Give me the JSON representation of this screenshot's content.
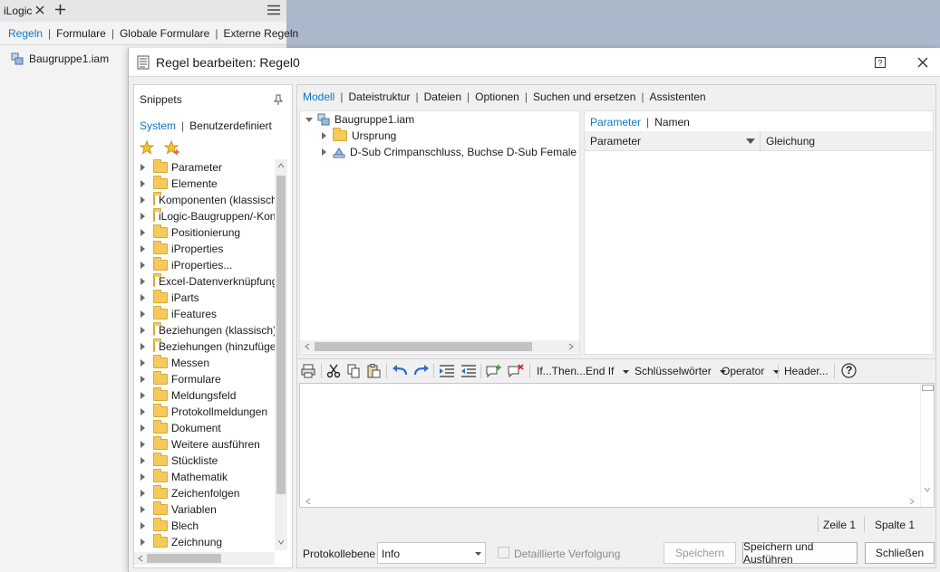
{
  "left_panel": {
    "title": "iLogic",
    "tabs": [
      "Regeln",
      "Formulare",
      "Globale Formulare",
      "Externe Regeln"
    ],
    "active_tab": "Regeln",
    "tree_item": "Baugruppe1.iam"
  },
  "dialog": {
    "title": "Regel bearbeiten: Regel0",
    "help_icon": "help-icon",
    "close_icon": "close-icon"
  },
  "snippets": {
    "title": "Snippets",
    "tabs": [
      "System",
      "Benutzerdefiniert"
    ],
    "active_tab": "System",
    "items": [
      "Parameter",
      "Elemente",
      "Komponenten (klassisch)",
      "iLogic-Baugruppen/-Konstruktion",
      "Positionierung",
      "iProperties",
      "iProperties...",
      "Excel-Datenverknüpfung",
      "iParts",
      "iFeatures",
      "Beziehungen (klassisch)",
      "Beziehungen (hinzufügen)",
      "Messen",
      "Formulare",
      "Meldungsfeld",
      "Protokollmeldungen",
      "Dokument",
      "Weitere ausführen",
      "Stückliste",
      "Mathematik",
      "Zeichenfolgen",
      "Variablen",
      "Blech",
      "Zeichnung"
    ]
  },
  "main_tabs": [
    "Modell",
    "Dateistruktur",
    "Dateien",
    "Optionen",
    "Suchen und ersetzen",
    "Assistenten"
  ],
  "main_active_tab": "Modell",
  "model_tree": {
    "root": "Baugruppe1.iam",
    "children": [
      "Ursprung",
      "D-Sub Crimpanschluss, Buchse D-Sub Female Crimp Socket"
    ]
  },
  "param_pane": {
    "tabs": [
      "Parameter",
      "Namen"
    ],
    "active_tab": "Parameter",
    "columns": [
      "Parameter",
      "Gleichung"
    ]
  },
  "toolbar": {
    "ifthen": "If...Then...End If",
    "keywords": "Schlüsselwörter",
    "operator": "Operator",
    "header": "Header...",
    "help": "?"
  },
  "status": {
    "line": "Zeile 1",
    "column": "Spalte 1"
  },
  "bottom": {
    "log_level_label": "Protokollebene",
    "log_level_value": "Info",
    "detailed_trace": "Detaillierte Verfolgung",
    "save": "Speichern",
    "save_run": "Speichern und Ausführen",
    "close": "Schließen"
  },
  "colors": {
    "accent": "#0b7ac3",
    "folder": "#f5c95a"
  }
}
